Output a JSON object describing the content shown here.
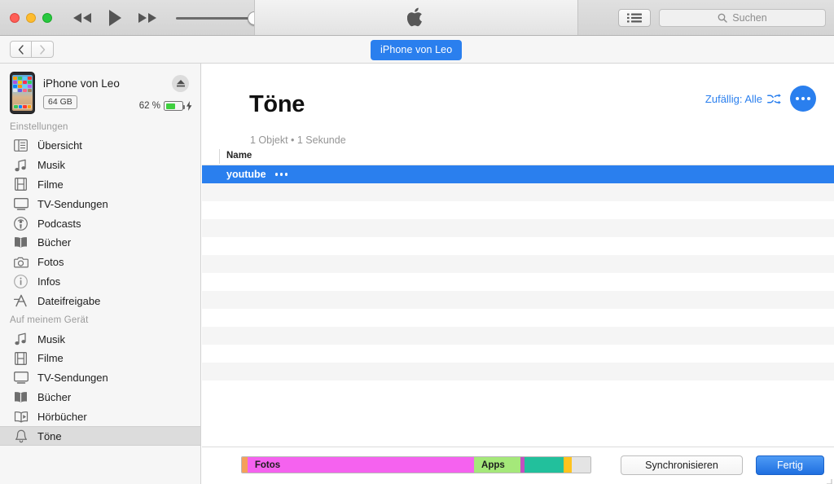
{
  "window": {
    "traffic_lights": [
      "close",
      "minimize",
      "zoom"
    ],
    "lcd_logo": "apple-logo"
  },
  "toolbar": {
    "rewind": "rewind-icon",
    "play": "play-icon",
    "forward": "fast-forward-icon",
    "volume_value": 85,
    "list_button": "list-view-icon",
    "search_placeholder": "Suchen"
  },
  "navbar": {
    "back": "chevron-left-icon",
    "forward": "chevron-right-icon",
    "device_tab": "iPhone von Leo"
  },
  "device": {
    "name": "iPhone von Leo",
    "capacity": "64 GB",
    "battery_percent": "62 %",
    "battery_level": 62,
    "charging": true,
    "eject": "eject-icon"
  },
  "sidebar": {
    "sections": [
      {
        "title": "Einstellungen",
        "items": [
          {
            "label": "Übersicht",
            "icon": "overview-icon",
            "selected": false
          },
          {
            "label": "Musik",
            "icon": "music-note-icon",
            "selected": false
          },
          {
            "label": "Filme",
            "icon": "film-icon",
            "selected": false
          },
          {
            "label": "TV-Sendungen",
            "icon": "tv-icon",
            "selected": false
          },
          {
            "label": "Podcasts",
            "icon": "podcast-icon",
            "selected": false
          },
          {
            "label": "Bücher",
            "icon": "book-icon",
            "selected": false
          },
          {
            "label": "Fotos",
            "icon": "camera-icon",
            "selected": false
          },
          {
            "label": "Infos",
            "icon": "info-icon",
            "selected": false
          },
          {
            "label": "Dateifreigabe",
            "icon": "file-sharing-icon",
            "selected": false
          }
        ]
      },
      {
        "title": "Auf meinem Gerät",
        "items": [
          {
            "label": "Musik",
            "icon": "music-note-icon",
            "selected": false
          },
          {
            "label": "Filme",
            "icon": "film-icon",
            "selected": false
          },
          {
            "label": "TV-Sendungen",
            "icon": "tv-icon",
            "selected": false
          },
          {
            "label": "Bücher",
            "icon": "book-icon",
            "selected": false
          },
          {
            "label": "Hörbücher",
            "icon": "audiobook-icon",
            "selected": false
          },
          {
            "label": "Töne",
            "icon": "bell-icon",
            "selected": true
          }
        ]
      }
    ]
  },
  "main": {
    "title": "Töne",
    "subtitle": "1 Objekt • 1 Sekunde",
    "shuffle_label": "Zufällig: Alle",
    "shuffle_icon": "shuffle-icon",
    "more_button": "more-options-icon",
    "columns": [
      "Name"
    ],
    "rows": [
      {
        "name": "youtube",
        "badge": "•••",
        "selected": true
      }
    ],
    "empty_row_count": 12
  },
  "footer": {
    "capacity_segments": [
      {
        "label": "",
        "color": "#f5a05a",
        "width_pct": 1.6
      },
      {
        "label": "Fotos",
        "color": "#f562ef",
        "width_pct": 65.0
      },
      {
        "label": "Apps",
        "color": "#a5e87a",
        "width_pct": 13.2
      },
      {
        "label": "",
        "color": "#c34fc0",
        "width_pct": 1.2
      },
      {
        "label": "",
        "color": "#22c09c",
        "width_pct": 11.2
      },
      {
        "label": "",
        "color": "#ffc31e",
        "width_pct": 2.4
      },
      {
        "label": "",
        "color": "#e4e4e4",
        "width_pct": 5.4
      }
    ],
    "sync_button": "Synchronisieren",
    "done_button": "Fertig"
  },
  "colors": {
    "accent_blue": "#2a7fee",
    "selection_blue": "#2a7fee",
    "sidebar_bg": "#f6f6f6",
    "row_stripe": "#f5f5f5",
    "battery_green": "#3fd03f"
  }
}
